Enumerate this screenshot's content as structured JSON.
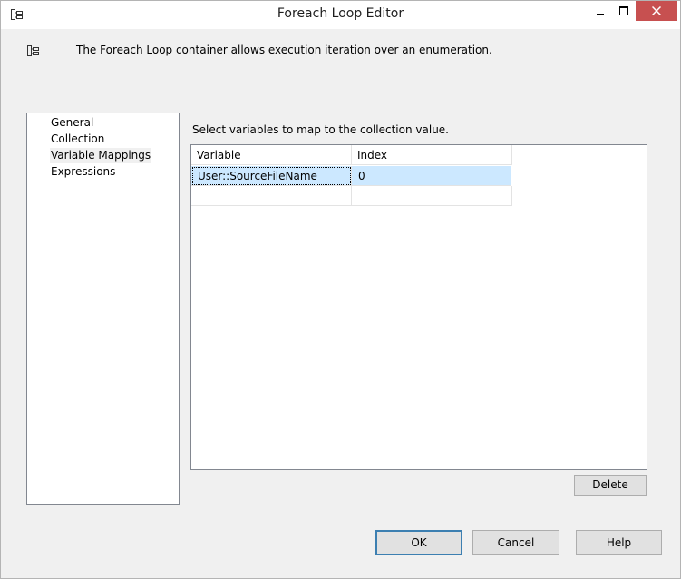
{
  "window": {
    "title": "Foreach Loop Editor",
    "icon": "foreach-container-icon"
  },
  "description": {
    "icon": "foreach-container-icon",
    "text": "The Foreach Loop container allows execution iteration over an enumeration."
  },
  "nav": {
    "items": [
      {
        "label": "General"
      },
      {
        "label": "Collection"
      },
      {
        "label": "Variable Mappings",
        "selected": true
      },
      {
        "label": "Expressions"
      }
    ]
  },
  "panel": {
    "instruction": "Select variables to map to the collection value.",
    "columns": [
      "Variable",
      "Index"
    ],
    "rows": [
      {
        "variable": "User::SourceFileName",
        "index": "0",
        "selected": true
      },
      {
        "variable": "",
        "index": ""
      }
    ]
  },
  "buttons": {
    "delete": "Delete",
    "ok": "OK",
    "cancel": "Cancel",
    "help": "Help"
  },
  "colors": {
    "selection": "#cce8ff",
    "close_button": "#c75050"
  }
}
